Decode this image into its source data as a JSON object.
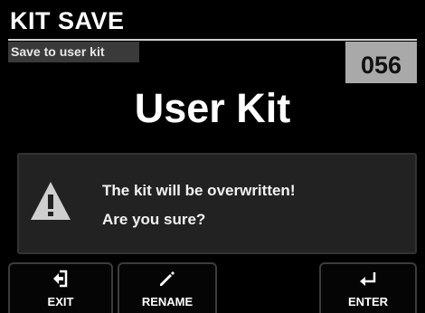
{
  "header": {
    "title": "KIT SAVE"
  },
  "subtitle": "Save to user kit",
  "kit": {
    "number": "056",
    "name": "User Kit"
  },
  "dialog": {
    "icon": "warning-triangle-icon",
    "line1": "The kit will be overwritten!",
    "line2": "Are you sure?"
  },
  "function_keys": [
    {
      "label": "EXIT",
      "icon": "exit-arrow-icon"
    },
    {
      "label": "RENAME",
      "icon": "pencil-icon"
    },
    {
      "label": "ENTER",
      "icon": "enter-return-icon"
    }
  ],
  "colors": {
    "background": "#000000",
    "kit_number_bg": "#a9a9a9",
    "subtitle_bg": "#3a3a3a",
    "dialog_bg": "#222222",
    "warning_icon": "#cfcfcf"
  }
}
